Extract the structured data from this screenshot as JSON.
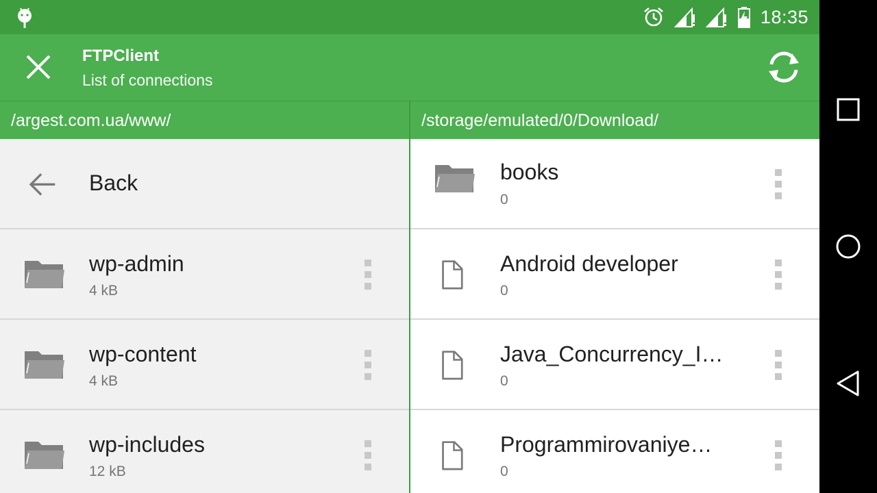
{
  "status_bar": {
    "time": "18:35",
    "icons": [
      "android-debug-icon",
      "alarm-icon",
      "signal-icon",
      "signal-icon",
      "battery-charging-icon"
    ]
  },
  "app_bar": {
    "title": "FTPClient",
    "subtitle": "List of connections",
    "close_icon": "close-icon",
    "refresh_icon": "refresh-icon"
  },
  "left_pane": {
    "path": "/argest.com.ua/www/",
    "back_label": "Back",
    "items": [
      {
        "name": "wp-admin",
        "size": "4 kB",
        "icon": "folder-icon"
      },
      {
        "name": "wp-content",
        "size": "4 kB",
        "icon": "folder-icon"
      },
      {
        "name": "wp-includes",
        "size": "12 kB",
        "icon": "folder-icon"
      }
    ]
  },
  "right_pane": {
    "path": "/storage/emulated/0/Download/",
    "items": [
      {
        "name": "books",
        "size": "0",
        "icon": "folder-icon"
      },
      {
        "name": "Android developer",
        "size": "0",
        "icon": "file-icon"
      },
      {
        "name": "Java_Concurrency_I…",
        "size": "0",
        "icon": "file-icon"
      },
      {
        "name": "Programmirovaniye…",
        "size": "0",
        "icon": "file-icon"
      }
    ]
  },
  "colors": {
    "status_bar": "#3e9d3e",
    "app_bar": "#4caf50",
    "icon_gray": "#808080"
  }
}
